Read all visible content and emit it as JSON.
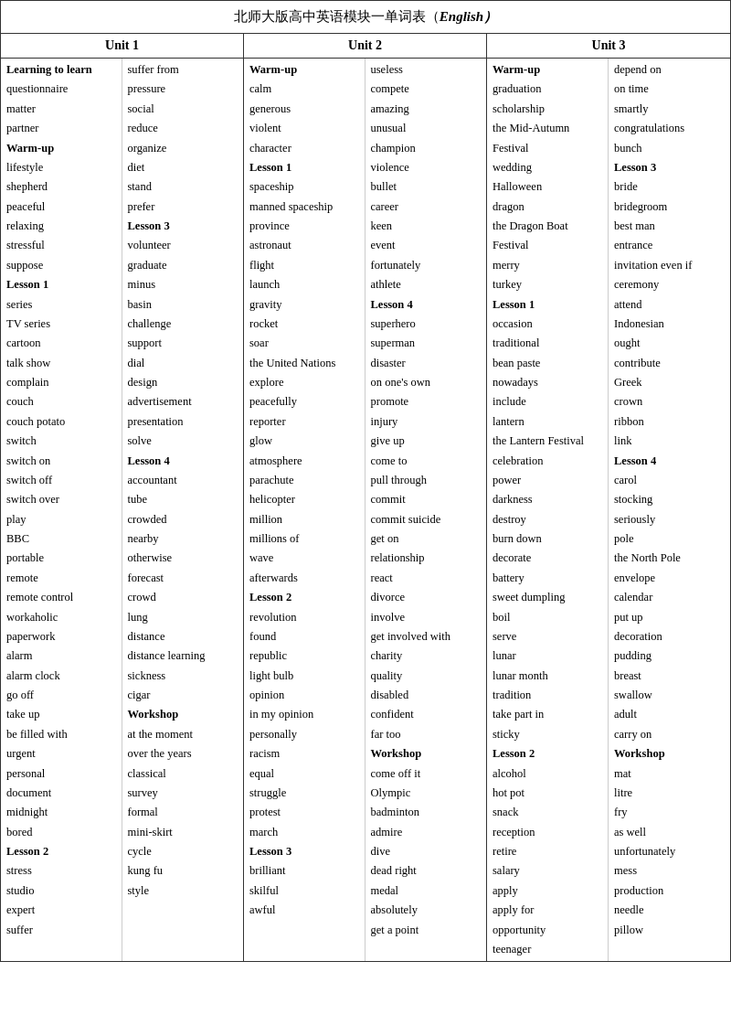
{
  "title": "北师大版高中英语模块一单词表（",
  "title_english": "English）",
  "units": [
    {
      "header": "Unit 1",
      "col1": [
        {
          "text": "Learning to learn",
          "bold": true
        },
        {
          "text": "questionnaire"
        },
        {
          "text": "matter"
        },
        {
          "text": "partner"
        },
        {
          "text": "Warm-up",
          "bold": true
        },
        {
          "text": "lifestyle"
        },
        {
          "text": "shepherd"
        },
        {
          "text": "peaceful"
        },
        {
          "text": "relaxing"
        },
        {
          "text": "stressful"
        },
        {
          "text": "suppose"
        },
        {
          "text": "Lesson 1",
          "bold": true
        },
        {
          "text": "series"
        },
        {
          "text": "TV series"
        },
        {
          "text": "cartoon"
        },
        {
          "text": "talk show"
        },
        {
          "text": "complain"
        },
        {
          "text": "couch"
        },
        {
          "text": "couch potato"
        },
        {
          "text": "switch"
        },
        {
          "text": "switch on"
        },
        {
          "text": "switch off"
        },
        {
          "text": "switch over"
        },
        {
          "text": "play"
        },
        {
          "text": "BBC"
        },
        {
          "text": "portable"
        },
        {
          "text": "remote"
        },
        {
          "text": "remote control"
        },
        {
          "text": "workaholic"
        },
        {
          "text": "paperwork"
        },
        {
          "text": "alarm"
        },
        {
          "text": "alarm clock"
        },
        {
          "text": "go off"
        },
        {
          "text": "take up"
        },
        {
          "text": "be filled with"
        },
        {
          "text": "urgent"
        },
        {
          "text": "personal"
        },
        {
          "text": "document"
        },
        {
          "text": "midnight"
        },
        {
          "text": "bored"
        },
        {
          "text": "Lesson 2",
          "bold": true
        },
        {
          "text": "stress"
        },
        {
          "text": "studio"
        },
        {
          "text": "expert"
        },
        {
          "text": "suffer"
        }
      ],
      "col2": [
        {
          "text": "suffer from"
        },
        {
          "text": "pressure"
        },
        {
          "text": "social"
        },
        {
          "text": "reduce"
        },
        {
          "text": "organize"
        },
        {
          "text": "diet"
        },
        {
          "text": "stand"
        },
        {
          "text": "prefer"
        },
        {
          "text": "Lesson 3",
          "bold": true
        },
        {
          "text": "volunteer"
        },
        {
          "text": "graduate"
        },
        {
          "text": "minus"
        },
        {
          "text": "basin"
        },
        {
          "text": "challenge"
        },
        {
          "text": "support"
        },
        {
          "text": "dial"
        },
        {
          "text": "design"
        },
        {
          "text": "advertisement"
        },
        {
          "text": "presentation"
        },
        {
          "text": "solve"
        },
        {
          "text": "Lesson 4",
          "bold": true
        },
        {
          "text": "accountant"
        },
        {
          "text": "tube"
        },
        {
          "text": "crowded"
        },
        {
          "text": "nearby"
        },
        {
          "text": "otherwise"
        },
        {
          "text": "forecast"
        },
        {
          "text": "crowd"
        },
        {
          "text": "lung"
        },
        {
          "text": "distance"
        },
        {
          "text": "distance learning"
        },
        {
          "text": "sickness"
        },
        {
          "text": "cigar"
        },
        {
          "text": "Workshop",
          "bold": true
        },
        {
          "text": "at the moment"
        },
        {
          "text": "over the years"
        },
        {
          "text": "classical"
        },
        {
          "text": "survey"
        },
        {
          "text": "formal"
        },
        {
          "text": "mini-skirt"
        },
        {
          "text": "cycle"
        },
        {
          "text": "kung fu"
        },
        {
          "text": "style"
        },
        {
          "text": ""
        },
        {
          "text": ""
        }
      ]
    },
    {
      "header": "Unit 2",
      "col1": [
        {
          "text": "Warm-up",
          "bold": true
        },
        {
          "text": "calm"
        },
        {
          "text": "generous"
        },
        {
          "text": "violent"
        },
        {
          "text": "character"
        },
        {
          "text": "Lesson 1",
          "bold": true
        },
        {
          "text": "spaceship"
        },
        {
          "text": "manned spaceship"
        },
        {
          "text": "province"
        },
        {
          "text": "astronaut"
        },
        {
          "text": "flight"
        },
        {
          "text": "launch"
        },
        {
          "text": "gravity"
        },
        {
          "text": "rocket"
        },
        {
          "text": "soar"
        },
        {
          "text": "the United Nations"
        },
        {
          "text": "explore"
        },
        {
          "text": "peacefully"
        },
        {
          "text": "reporter"
        },
        {
          "text": "glow"
        },
        {
          "text": "atmosphere"
        },
        {
          "text": "parachute"
        },
        {
          "text": "helicopter"
        },
        {
          "text": "million"
        },
        {
          "text": "millions of"
        },
        {
          "text": "wave"
        },
        {
          "text": "afterwards"
        },
        {
          "text": "Lesson 2",
          "bold": true
        },
        {
          "text": "revolution"
        },
        {
          "text": "found"
        },
        {
          "text": "republic"
        },
        {
          "text": "light bulb"
        },
        {
          "text": "opinion"
        },
        {
          "text": "in my opinion"
        },
        {
          "text": "personally"
        },
        {
          "text": "racism"
        },
        {
          "text": "equal"
        },
        {
          "text": "struggle"
        },
        {
          "text": "protest"
        },
        {
          "text": "march"
        },
        {
          "text": "Lesson 3",
          "bold": true
        },
        {
          "text": "brilliant"
        },
        {
          "text": "skilful"
        },
        {
          "text": "awful"
        },
        {
          "text": ""
        }
      ],
      "col2": [
        {
          "text": "useless"
        },
        {
          "text": "compete"
        },
        {
          "text": "amazing"
        },
        {
          "text": "unusual"
        },
        {
          "text": "champion"
        },
        {
          "text": "violence"
        },
        {
          "text": "bullet"
        },
        {
          "text": "career"
        },
        {
          "text": "keen"
        },
        {
          "text": "event"
        },
        {
          "text": "fortunately"
        },
        {
          "text": "athlete"
        },
        {
          "text": "Lesson 4",
          "bold": true
        },
        {
          "text": "superhero"
        },
        {
          "text": "superman"
        },
        {
          "text": "disaster"
        },
        {
          "text": "on one's own"
        },
        {
          "text": "promote"
        },
        {
          "text": "injury"
        },
        {
          "text": "give up"
        },
        {
          "text": "come to"
        },
        {
          "text": "pull through"
        },
        {
          "text": "commit"
        },
        {
          "text": "commit suicide"
        },
        {
          "text": "get on"
        },
        {
          "text": "relationship"
        },
        {
          "text": "react"
        },
        {
          "text": "divorce"
        },
        {
          "text": "involve"
        },
        {
          "text": "get involved with"
        },
        {
          "text": "charity"
        },
        {
          "text": "quality"
        },
        {
          "text": "disabled"
        },
        {
          "text": "confident"
        },
        {
          "text": "far too"
        },
        {
          "text": "Workshop",
          "bold": true
        },
        {
          "text": "come off it"
        },
        {
          "text": "Olympic"
        },
        {
          "text": "badminton"
        },
        {
          "text": "admire"
        },
        {
          "text": "dive"
        },
        {
          "text": "dead right"
        },
        {
          "text": "medal"
        },
        {
          "text": "absolutely"
        },
        {
          "text": "get a point"
        }
      ]
    },
    {
      "header": "Unit 3",
      "col1": [
        {
          "text": "Warm-up",
          "bold": true
        },
        {
          "text": "graduation"
        },
        {
          "text": "scholarship"
        },
        {
          "text": "the   Mid-Autumn"
        },
        {
          "text": "Festival"
        },
        {
          "text": "wedding"
        },
        {
          "text": "Halloween"
        },
        {
          "text": "dragon"
        },
        {
          "text": "the Dragon Boat"
        },
        {
          "text": "Festival"
        },
        {
          "text": "merry"
        },
        {
          "text": "turkey"
        },
        {
          "text": "Lesson 1",
          "bold": true
        },
        {
          "text": "occasion"
        },
        {
          "text": "traditional"
        },
        {
          "text": "bean paste"
        },
        {
          "text": "nowadays"
        },
        {
          "text": "include"
        },
        {
          "text": "lantern"
        },
        {
          "text": "the Lantern Festival"
        },
        {
          "text": "celebration"
        },
        {
          "text": "power"
        },
        {
          "text": "darkness"
        },
        {
          "text": "destroy"
        },
        {
          "text": "burn down"
        },
        {
          "text": "decorate"
        },
        {
          "text": "battery"
        },
        {
          "text": "sweet dumpling"
        },
        {
          "text": "boil"
        },
        {
          "text": "serve"
        },
        {
          "text": "lunar"
        },
        {
          "text": "lunar month"
        },
        {
          "text": "tradition"
        },
        {
          "text": "take part in"
        },
        {
          "text": "sticky"
        },
        {
          "text": "Lesson 2",
          "bold": true
        },
        {
          "text": "alcohol"
        },
        {
          "text": "hot pot"
        },
        {
          "text": "snack"
        },
        {
          "text": "reception"
        },
        {
          "text": "retire"
        },
        {
          "text": "salary"
        },
        {
          "text": "apply"
        },
        {
          "text": "apply for"
        },
        {
          "text": "opportunity"
        },
        {
          "text": "teenager"
        }
      ],
      "col2": [
        {
          "text": "depend on"
        },
        {
          "text": "on time"
        },
        {
          "text": "smartly"
        },
        {
          "text": "congratulations"
        },
        {
          "text": "bunch"
        },
        {
          "text": "Lesson 3",
          "bold": true
        },
        {
          "text": "bride"
        },
        {
          "text": "bridegroom"
        },
        {
          "text": "best man"
        },
        {
          "text": "entrance"
        },
        {
          "text": "invitation even if"
        },
        {
          "text": "ceremony"
        },
        {
          "text": "attend"
        },
        {
          "text": "Indonesian"
        },
        {
          "text": "ought"
        },
        {
          "text": "contribute"
        },
        {
          "text": "Greek"
        },
        {
          "text": "crown"
        },
        {
          "text": "ribbon"
        },
        {
          "text": "link"
        },
        {
          "text": "Lesson 4",
          "bold": true
        },
        {
          "text": "carol"
        },
        {
          "text": "stocking"
        },
        {
          "text": "seriously"
        },
        {
          "text": "pole"
        },
        {
          "text": "the North Pole"
        },
        {
          "text": "envelope"
        },
        {
          "text": "calendar"
        },
        {
          "text": "put up"
        },
        {
          "text": "decoration"
        },
        {
          "text": "pudding"
        },
        {
          "text": "breast"
        },
        {
          "text": "swallow"
        },
        {
          "text": "adult"
        },
        {
          "text": "carry on"
        },
        {
          "text": "Workshop",
          "bold": true
        },
        {
          "text": "mat"
        },
        {
          "text": "litre"
        },
        {
          "text": "fry"
        },
        {
          "text": "as well"
        },
        {
          "text": "unfortunately"
        },
        {
          "text": "mess"
        },
        {
          "text": "production"
        },
        {
          "text": "needle"
        },
        {
          "text": "pillow"
        }
      ]
    }
  ]
}
